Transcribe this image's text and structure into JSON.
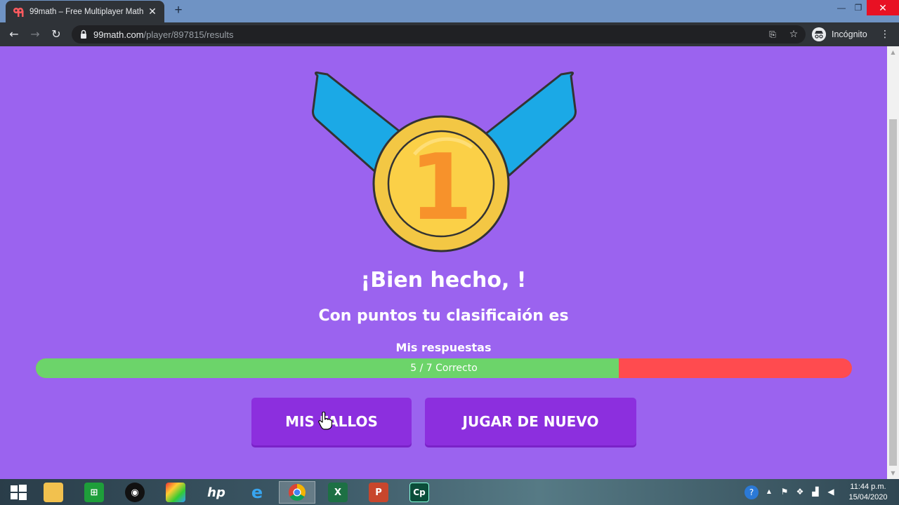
{
  "browser": {
    "tab_title": "99math – Free Multiplayer Math",
    "tab_close": "✕",
    "new_tab": "+",
    "url_domain": "99math.com",
    "url_path": "/player/897815/results",
    "profile_label": "Incógnito",
    "window_minimize": "—",
    "window_restore": "❐",
    "window_close": "✕"
  },
  "page": {
    "medal_number": "1",
    "headline": "¡Bien hecho, !",
    "subline": "Con puntos tu clasificaión es",
    "answers_label": "Mis respuestas",
    "progress": {
      "correct": 5,
      "total": 7,
      "label": "5 / 7 Correcto",
      "correct_color": "#6cd46a",
      "wrong_color": "#ff4b4f"
    },
    "buttons": {
      "mistakes": "MIS FALLOS",
      "replay": "JUGAR DE NUEVO"
    },
    "colors": {
      "background": "#9b63ef",
      "button": "#8c2fde"
    }
  },
  "taskbar": {
    "apps": [
      "start",
      "file-explorer",
      "store",
      "obs",
      "photo-app",
      "hp",
      "internet-explorer",
      "chrome",
      "excel",
      "powerpoint",
      "captivate"
    ],
    "active_app": "chrome",
    "clock_time": "11:44 p.m.",
    "clock_date": "15/04/2020"
  }
}
